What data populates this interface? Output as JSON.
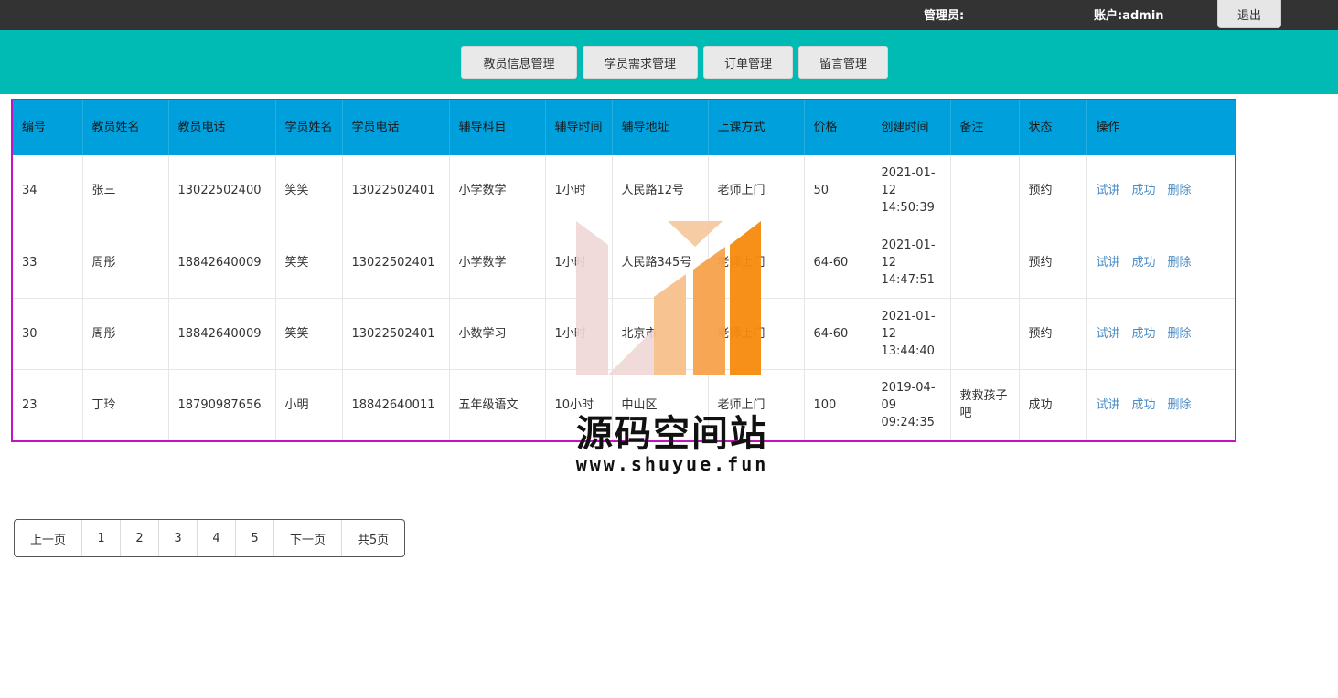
{
  "header": {
    "admin_label": "管理员:",
    "account_label": "账户:admin",
    "logout_label": "退出"
  },
  "nav": {
    "items": [
      {
        "label": "教员信息管理"
      },
      {
        "label": "学员需求管理"
      },
      {
        "label": "订单管理"
      },
      {
        "label": "留言管理"
      }
    ]
  },
  "table": {
    "columns": [
      "编号",
      "教员姓名",
      "教员电话",
      "学员姓名",
      "学员电话",
      "辅导科目",
      "辅导时间",
      "辅导地址",
      "上课方式",
      "价格",
      "创建时间",
      "备注",
      "状态",
      "操作"
    ],
    "rows": [
      {
        "id": "34",
        "teacher": "张三",
        "teacher_phone": "13022502400",
        "student": "笑笑",
        "student_phone": "13022502401",
        "subject": "小学数学",
        "duration": "1小时",
        "address": "人民路12号",
        "mode": "老师上门",
        "price": "50",
        "created": "2021-01-12 14:50:39",
        "note": "",
        "status": "预约"
      },
      {
        "id": "33",
        "teacher": "周彤",
        "teacher_phone": "18842640009",
        "student": "笑笑",
        "student_phone": "13022502401",
        "subject": "小学数学",
        "duration": "1小时",
        "address": "人民路345号",
        "mode": "老师上门",
        "price": "64-60",
        "created": "2021-01-12 14:47:51",
        "note": "",
        "status": "预约"
      },
      {
        "id": "30",
        "teacher": "周彤",
        "teacher_phone": "18842640009",
        "student": "笑笑",
        "student_phone": "13022502401",
        "subject": "小数学习",
        "duration": "1小时",
        "address": "北京市",
        "mode": "老师上门",
        "price": "64-60",
        "created": "2021-01-12 13:44:40",
        "note": "",
        "status": "预约"
      },
      {
        "id": "23",
        "teacher": "丁玲",
        "teacher_phone": "18790987656",
        "student": "小明",
        "student_phone": "18842640011",
        "subject": "五年级语文",
        "duration": "10小时",
        "address": "中山区",
        "mode": "老师上门",
        "price": "100",
        "created": "2019-04-09 09:24:35",
        "note": "救救孩子吧",
        "status": "成功"
      }
    ],
    "actions": {
      "trial": "试讲",
      "success": "成功",
      "delete": "删除"
    }
  },
  "pagination": {
    "prev": "上一页",
    "pages": [
      "1",
      "2",
      "3",
      "4",
      "5"
    ],
    "next": "下一页",
    "total": "共5页"
  },
  "watermark": {
    "title": "源码空间站",
    "url": "www.shuyue.fun"
  },
  "colors": {
    "topbar": "#333333",
    "navbar": "#00bbb4",
    "table_header": "#00a0dc",
    "table_border": "#c313c3",
    "action_link": "#4a8bc4"
  }
}
